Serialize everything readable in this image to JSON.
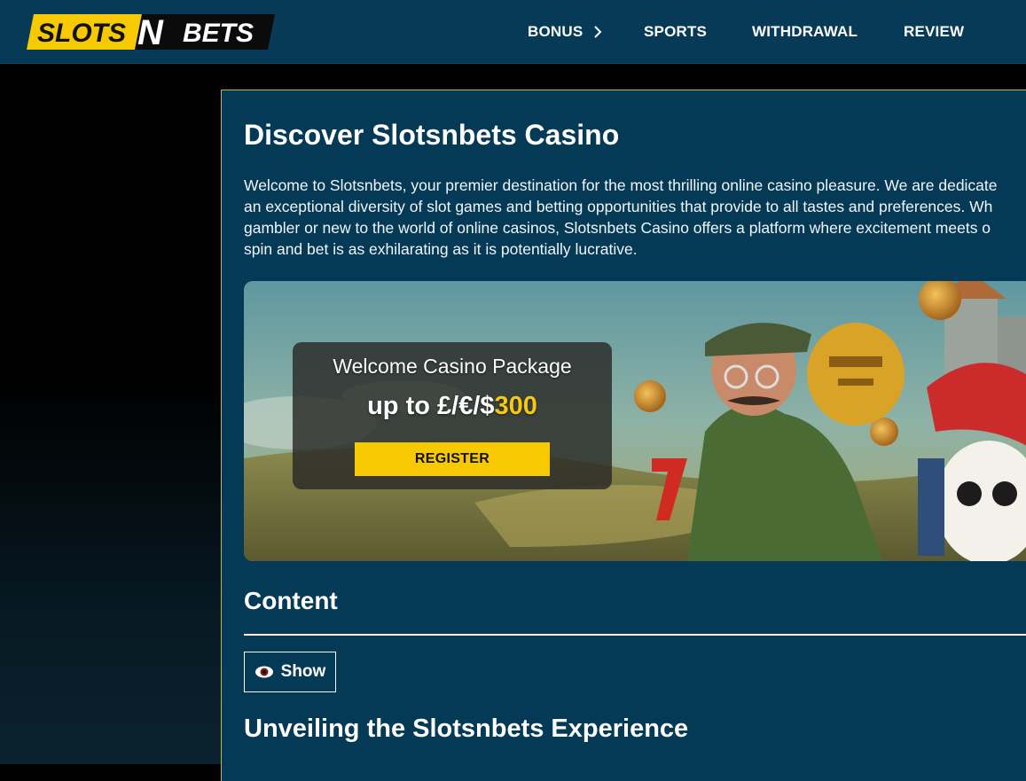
{
  "header": {
    "logo": {
      "part1": "SLOTS",
      "part2": "N",
      "part3": "BETS"
    },
    "nav": [
      {
        "label": "BONUS",
        "icon": "chevron-right-icon"
      },
      {
        "label": "SPORTS"
      },
      {
        "label": "WITHDRAWAL"
      },
      {
        "label": "REVIEW"
      }
    ]
  },
  "main": {
    "title": "Discover Slotsnbets Casino",
    "intro_lines": [
      "Welcome to Slotsnbets, your premier destination for the most thrilling online casino pleasure. We are dedicate",
      "an exceptional diversity of slot games and betting opportunities that provide to all tastes and preferences. Wh",
      "gambler or new to the world of online casinos, Slotsnbets Casino offers a platform where excitement meets o",
      "spin and bet is as exhilarating as it is potentially lucrative."
    ],
    "promo": {
      "title": "Welcome Casino Package",
      "amount_prefix": "up to £/€/$",
      "amount_value": "300",
      "register_label": "REGISTER"
    },
    "content_heading": "Content",
    "show_label": "Show",
    "show_icon": "eye-icon",
    "section_heading": "Unveiling the Slotsnbets Experience"
  },
  "colors": {
    "header_bg": "#073a57",
    "card_bg": "#053a56",
    "accent_yellow": "#f7c900"
  }
}
